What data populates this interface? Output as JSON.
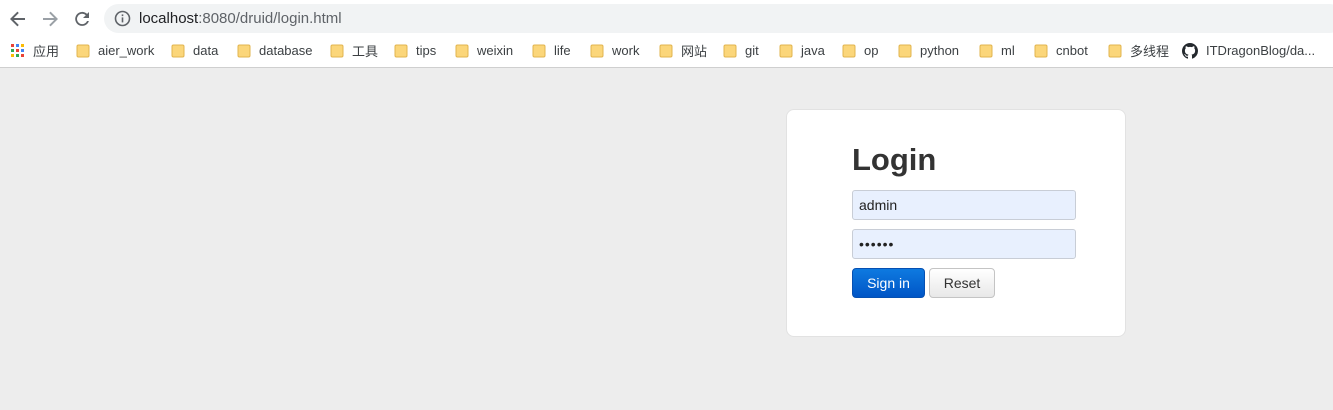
{
  "browser": {
    "url_host": "localhost",
    "url_rest": ":8080/druid/login.html"
  },
  "bookmarks": {
    "apps_label": "应用",
    "items": [
      {
        "label": "aier_work",
        "icon": "folder-icon"
      },
      {
        "label": "data",
        "icon": "folder-icon"
      },
      {
        "label": "database",
        "icon": "folder-icon"
      },
      {
        "label": "工具",
        "icon": "folder-icon"
      },
      {
        "label": "tips",
        "icon": "folder-icon"
      },
      {
        "label": "weixin",
        "icon": "folder-icon"
      },
      {
        "label": "life",
        "icon": "folder-icon"
      },
      {
        "label": "work",
        "icon": "folder-icon"
      },
      {
        "label": "网站",
        "icon": "folder-icon"
      },
      {
        "label": "git",
        "icon": "folder-icon"
      },
      {
        "label": "java",
        "icon": "folder-icon"
      },
      {
        "label": "op",
        "icon": "folder-icon"
      },
      {
        "label": "python",
        "icon": "folder-icon"
      },
      {
        "label": "ml",
        "icon": "folder-icon"
      },
      {
        "label": "cnbot",
        "icon": "folder-icon"
      },
      {
        "label": "多线程",
        "icon": "folder-icon"
      },
      {
        "label": "ITDragonBlog/da...",
        "icon": "github-icon"
      }
    ]
  },
  "login": {
    "title": "Login",
    "username_value": "admin",
    "password_value": "••••••",
    "signin_label": "Sign in",
    "reset_label": "Reset"
  },
  "colors": {
    "page_background": "#ededed",
    "signin_button": "#0366d6",
    "input_autofill": "#e8f0fe"
  }
}
